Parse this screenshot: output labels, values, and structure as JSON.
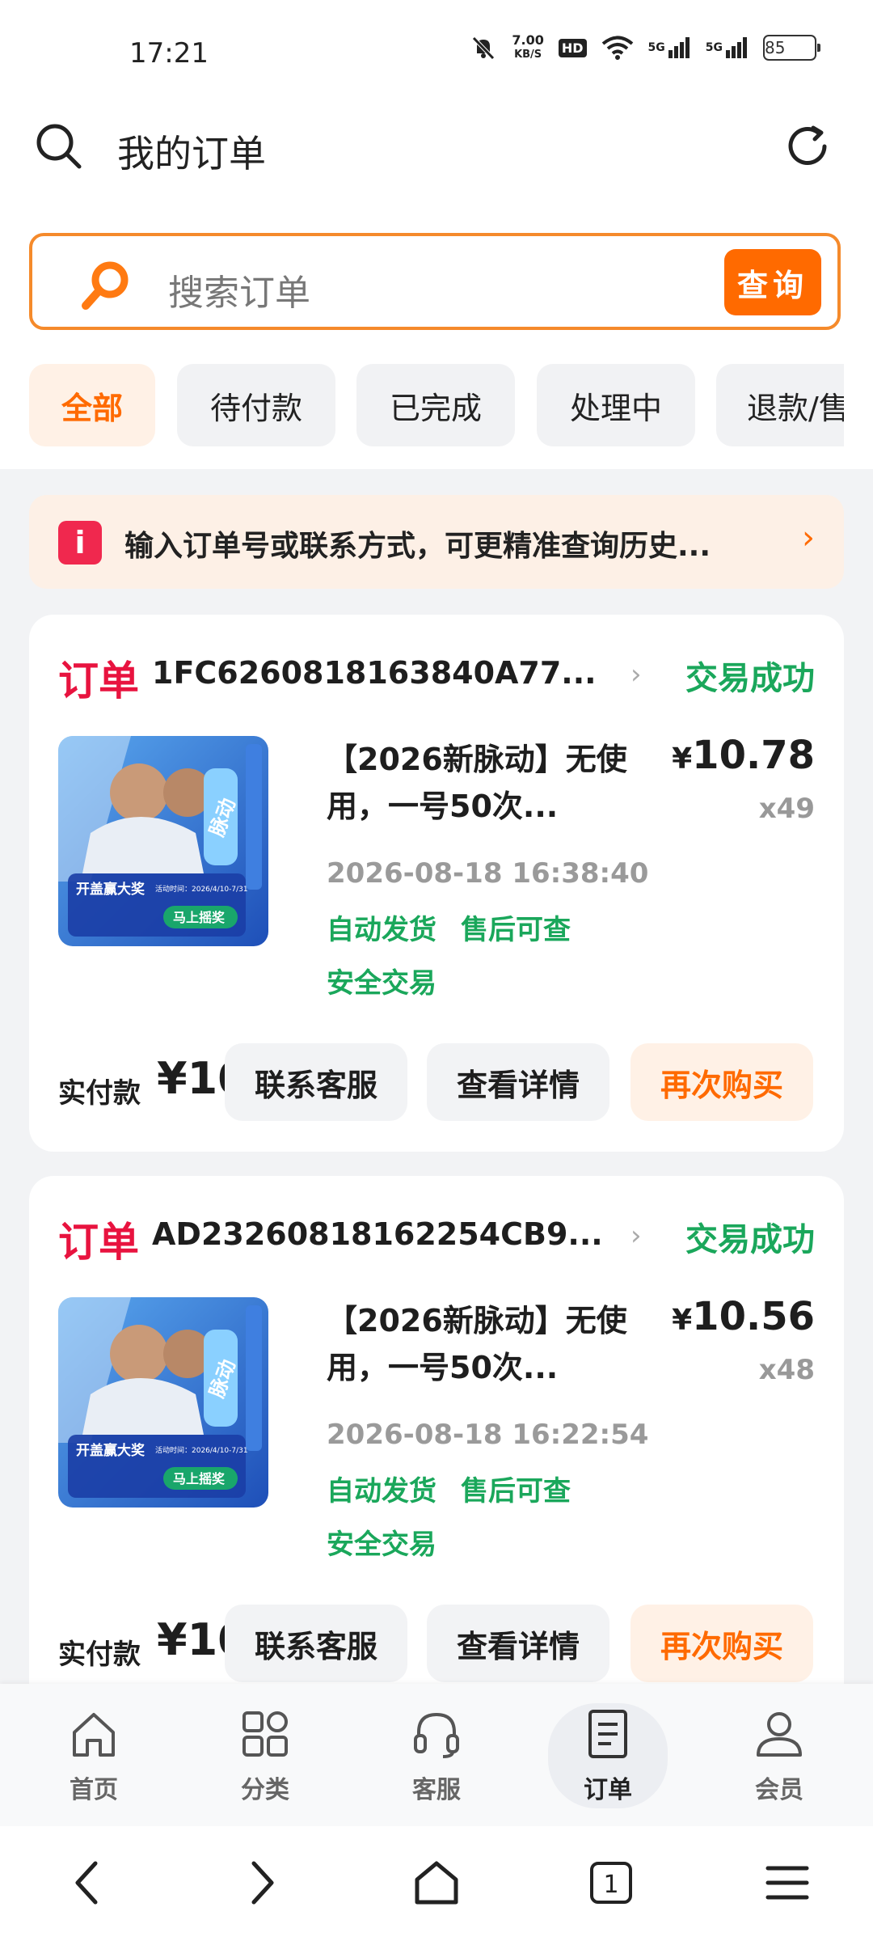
{
  "status_bar": {
    "time": "17:21",
    "net_speed_value": "7.00",
    "net_speed_unit": "KB/S",
    "hd": "HD",
    "signal1": "5G",
    "signal2": "5G",
    "battery": "85"
  },
  "header": {
    "title": "我的订单",
    "left_icon": "search-icon",
    "right_icon": "refresh-icon"
  },
  "search": {
    "placeholder": "搜索订单",
    "button": "查询"
  },
  "tabs": [
    {
      "label": "全部",
      "active": true
    },
    {
      "label": "待付款",
      "active": false
    },
    {
      "label": "已完成",
      "active": false
    },
    {
      "label": "处理中",
      "active": false
    },
    {
      "label": "退款/售",
      "active": false
    }
  ],
  "notice": {
    "icon": "i",
    "text": "输入订单号或联系方式，可更精准查询历史...",
    "chevron": "›"
  },
  "orders": [
    {
      "label": "订单",
      "number": "1FC6260818163840A77...",
      "chevron": "›",
      "status": "交易成功",
      "title": "【2026新脉动】无使用，一号50次...",
      "price": "10.78",
      "currency": "¥",
      "quantity": "x49",
      "time": "2026-08-18 16:38:40",
      "tags": [
        "自动发货",
        "售后可查",
        "安全交易"
      ],
      "paid_label": "实付款",
      "paid_amount": "¥10",
      "buttons": {
        "contact": "联系客服",
        "detail": "查看详情",
        "rebuy": "再次购买"
      },
      "image": {
        "banner": "开盖赢大奖",
        "button": "马上摇奖",
        "brand": "脉动",
        "date": "活动时间：2026/4/10-7/31"
      }
    },
    {
      "label": "订单",
      "number": "AD23260818162254CB9...",
      "chevron": "›",
      "status": "交易成功",
      "title": "【2026新脉动】无使用，一号50次...",
      "price": "10.56",
      "currency": "¥",
      "quantity": "x48",
      "time": "2026-08-18 16:22:54",
      "tags": [
        "自动发货",
        "售后可查",
        "安全交易"
      ],
      "paid_label": "实付款",
      "paid_amount": "¥10",
      "buttons": {
        "contact": "联系客服",
        "detail": "查看详情",
        "rebuy": "再次购买"
      },
      "image": {
        "banner": "开盖赢大奖",
        "button": "马上摇奖",
        "brand": "脉动",
        "date": "活动时间：2026/4/10-7/31"
      }
    }
  ],
  "bottom_nav": [
    {
      "label": "首页",
      "icon": "home-icon",
      "active": false
    },
    {
      "label": "分类",
      "icon": "grid-icon",
      "active": false
    },
    {
      "label": "客服",
      "icon": "headset-icon",
      "active": false
    },
    {
      "label": "订单",
      "icon": "document-icon",
      "active": true
    },
    {
      "label": "会员",
      "icon": "user-icon",
      "active": false
    }
  ],
  "system_nav": {
    "tabs_count": "1"
  },
  "colors": {
    "accent": "#ff6a00",
    "order_red": "#e8133f",
    "success_green": "#1aa75b",
    "notice_bg": "#fdf0e6"
  }
}
